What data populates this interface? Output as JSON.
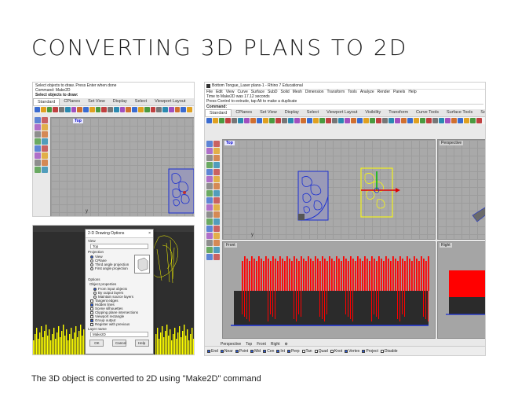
{
  "slide": {
    "title": "CONVERTING 3D PLANS TO 2D",
    "caption": "The 3D object is converted to 2D using \"Make2D\" command"
  },
  "shot1": {
    "cmd_line1": "Select objects to draw. Press Enter when done",
    "cmd_line2": "Command: Make2D",
    "prompt": "Select objects to draw:",
    "tabs": [
      "Standard",
      "CPlanes",
      "Set View",
      "Display",
      "Select",
      "Viewport Layout"
    ],
    "viewport_label": "Top",
    "axis_label": "y"
  },
  "shot2": {
    "dialog_title": "2-D Drawing Options",
    "close": "×",
    "view_label": "View",
    "view_value": "Top",
    "projection_label": "Projection",
    "projection_options": [
      "View",
      "CPlane",
      "Third angle projection",
      "First angle projection"
    ],
    "options_label": "Options",
    "object_properties_label": "Object properties",
    "object_properties_options": [
      "From input objects",
      "By output layers",
      "Maintain source layers"
    ],
    "checkbox_options": [
      {
        "label": "Tangent edges",
        "checked": false
      },
      {
        "label": "Hidden lines",
        "checked": true
      },
      {
        "label": "Scene silhouettes",
        "checked": false
      },
      {
        "label": "Clipping plane intersections",
        "checked": false
      },
      {
        "label": "Viewport rectangle",
        "checked": false
      },
      {
        "label": "Group output",
        "checked": true
      },
      {
        "label": "Register with previous",
        "checked": false
      }
    ],
    "layer_name_label": "Layer name",
    "layer_name_value": "Make2D",
    "buttons": [
      "OK",
      "Cancel",
      "Help"
    ]
  },
  "shot3": {
    "window_title": "Bottom Tongue_Laser plans-1 - Rhino 7 Educational",
    "menu": [
      "File",
      "Edit",
      "View",
      "Curve",
      "Surface",
      "SubD",
      "Solid",
      "Mesh",
      "Dimension",
      "Transform",
      "Tools",
      "Analyze",
      "Render",
      "Panels",
      "Help"
    ],
    "cmd_line1": "Time to Make2D was 17.12 seconds",
    "cmd_line2": "Press Control to extrude, tap Alt to make a duplicate",
    "cmd_prompt": "Command:",
    "tabs": [
      "Standard",
      "CPlanes",
      "Set View",
      "Display",
      "Select",
      "Viewport Layout",
      "Visibility",
      "Transform",
      "Curve Tools",
      "Surface Tools",
      "Solid Tools"
    ],
    "viewports": {
      "top": "Top",
      "perspective": "Perspective",
      "front": "Front",
      "right": "Right"
    },
    "view_tabs": [
      "Perspective",
      "Top",
      "Front",
      "Right"
    ],
    "snaps": [
      {
        "label": "End",
        "checked": true
      },
      {
        "label": "Near",
        "checked": true
      },
      {
        "label": "Point",
        "checked": true
      },
      {
        "label": "Mid",
        "checked": true
      },
      {
        "label": "Cen",
        "checked": true
      },
      {
        "label": "Int",
        "checked": true
      },
      {
        "label": "Perp",
        "checked": true
      },
      {
        "label": "Tan",
        "checked": false
      },
      {
        "label": "Quad",
        "checked": false
      },
      {
        "label": "Knot",
        "checked": false
      },
      {
        "label": "Vertex",
        "checked": true
      },
      {
        "label": "Project",
        "checked": true
      },
      {
        "label": "Disable",
        "checked": false
      }
    ]
  },
  "colors": {
    "viewport_bg": "#a9a9a9",
    "selection_blue": "#1a2fd0",
    "bar_red": "#ff0000",
    "bar_dark": "#2b2b2b",
    "yellow": "#ffff00"
  }
}
